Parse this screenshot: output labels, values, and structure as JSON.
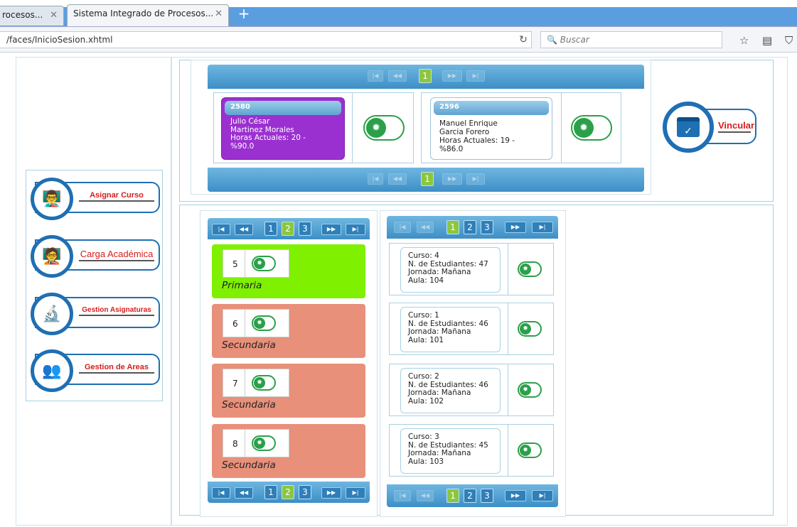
{
  "browser": {
    "tabs": [
      {
        "label": "rocesos...",
        "active": false
      },
      {
        "label": "Sistema Integrado de Procesos...",
        "active": true
      }
    ],
    "new_tab": "+",
    "url": "/faces/InicioSesion.xhtml",
    "search_placeholder": "Buscar"
  },
  "sidebar": {
    "items": [
      {
        "label": "Asignar Curso",
        "icon": "teacher-students-icon"
      },
      {
        "label": "Carga Académica",
        "icon": "teacher-board-icon"
      },
      {
        "label": "Gestion Asignaturas",
        "icon": "books-microscope-icon"
      },
      {
        "label": "Gestion de Areas",
        "icon": "people-network-icon"
      }
    ]
  },
  "students_pager": {
    "current_page": "1"
  },
  "students": [
    {
      "code": "2580",
      "name1": "Julio César",
      "name2": "Martinez Morales",
      "hours": "Horas Actuales: 20 -",
      "pct": "%90.0",
      "color": "#9b30d0",
      "selected": true
    },
    {
      "code": "2596",
      "name1": "Manuel Enrique",
      "name2": "Garcia Forero",
      "hours": "Horas Actuales: 19 -",
      "pct": "%86.0",
      "color": "#ffffff",
      "selected": false
    }
  ],
  "vincular": {
    "label": "Vincular",
    "icon": "calendar-check-icon"
  },
  "grades_pager": {
    "pages": [
      "1",
      "2",
      "3"
    ],
    "current": "2"
  },
  "grades": [
    {
      "number": "5",
      "level": "Primaria",
      "color": "#7ff000"
    },
    {
      "number": "6",
      "level": "Secundaria",
      "color": "#e8907a"
    },
    {
      "number": "7",
      "level": "Secundaria",
      "color": "#e8907a"
    },
    {
      "number": "8",
      "level": "Secundaria",
      "color": "#e8907a"
    }
  ],
  "courses_pager": {
    "pages": [
      "1",
      "2",
      "3"
    ],
    "current": "1"
  },
  "courses": [
    {
      "curso": "Curso: 4",
      "estudiantes": "N. de Estudiantes: 47",
      "jornada": "Jornada: Mañana",
      "aula": "Aula: 104"
    },
    {
      "curso": "Curso: 1",
      "estudiantes": "N. de Estudiantes: 46",
      "jornada": "Jornada: Mañana",
      "aula": "Aula: 101"
    },
    {
      "curso": "Curso: 2",
      "estudiantes": "N. de Estudiantes: 46",
      "jornada": "Jornada: Mañana",
      "aula": "Aula: 102"
    },
    {
      "curso": "Curso: 3",
      "estudiantes": "N. de Estudiantes: 45",
      "jornada": "Jornada: Mañana",
      "aula": "Aula: 103"
    }
  ],
  "pager_icons": {
    "first": "⏮",
    "prev": "⏪",
    "next": "⏩",
    "last": "⏭"
  },
  "colors": {
    "accent": "#1f6fb3",
    "pager": "#3d8fc6",
    "toggle": "#2aa04a",
    "current_page": "#8cc63f"
  }
}
